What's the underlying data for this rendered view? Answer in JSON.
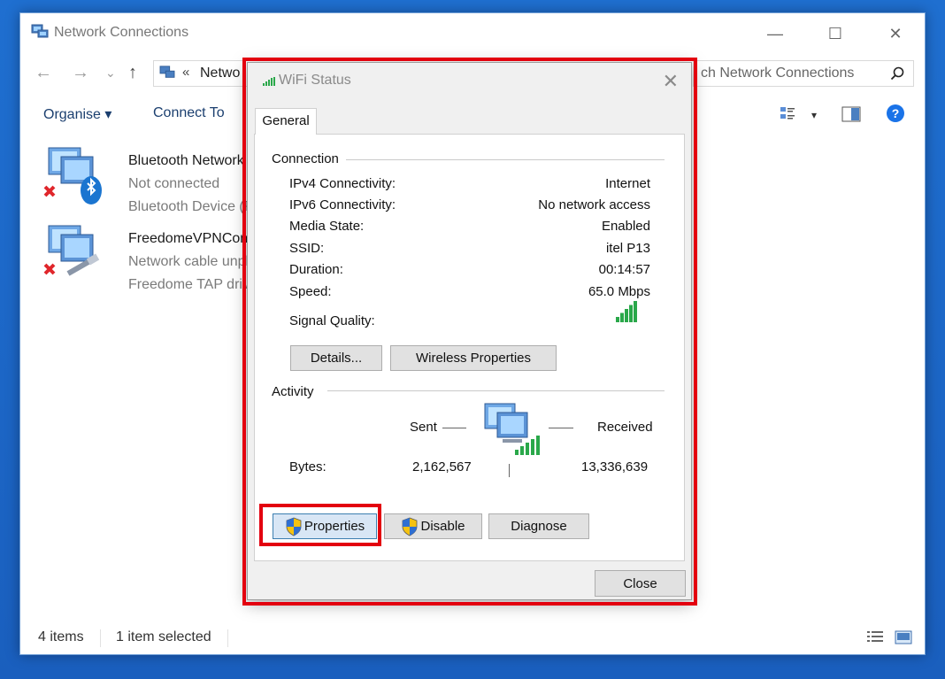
{
  "window": {
    "title": "Network Connections",
    "minimize_glyph": "—",
    "maximize_glyph": "☐",
    "close_glyph": "✕"
  },
  "nav": {
    "back_glyph": "←",
    "forward_glyph": "→",
    "recent_glyph": "⌄",
    "up_glyph": "↑",
    "address_chevron": "«",
    "address_text": "Netwo",
    "search_placeholder": "ch Network Connections"
  },
  "toolbar": {
    "organise_label": "Organise ▾",
    "connect_label": "Connect To",
    "view_dropdown_glyph": "▾"
  },
  "items": [
    {
      "name": "Bluetooth Network C",
      "status": "Not connected",
      "device": "Bluetooth Device (Pe",
      "icon": "bluetooth-network-icon"
    },
    {
      "name": "FreedomeVPNConne",
      "status": "Network cable unplu",
      "device": "Freedome TAP drive",
      "icon": "ethernet-network-icon"
    }
  ],
  "statusbar": {
    "count": "4 items",
    "selected": "1 item selected"
  },
  "dialog": {
    "title": "WiFi Status",
    "close_glyph": "✕",
    "tab": "General",
    "connection_heading": "Connection",
    "rows": [
      {
        "label": "IPv4 Connectivity:",
        "value": "Internet"
      },
      {
        "label": "IPv6 Connectivity:",
        "value": "No network access"
      },
      {
        "label": "Media State:",
        "value": "Enabled"
      },
      {
        "label": "SSID:",
        "value": "itel P13"
      },
      {
        "label": "Duration:",
        "value": "00:14:57"
      },
      {
        "label": "Speed:",
        "value": "65.0 Mbps"
      }
    ],
    "signal_label": "Signal Quality:",
    "signal_bars_filled": 5,
    "signal_bars_total": 5,
    "details_button": "Details...",
    "wireless_button": "Wireless Properties",
    "activity_heading": "Activity",
    "sent_label": "Sent",
    "received_label": "Received",
    "bytes_label": "Bytes:",
    "bytes_sent": "2,162,567",
    "bytes_received": "13,336,639",
    "properties_button": "Properties",
    "disable_button": "Disable",
    "diagnose_button": "Diagnose",
    "close_button": "Close"
  },
  "colors": {
    "highlight": "#e3000f",
    "signal_green": "#2aa84a",
    "help_blue": "#1a73e8",
    "desktop_blue": "#1f6fd0"
  }
}
